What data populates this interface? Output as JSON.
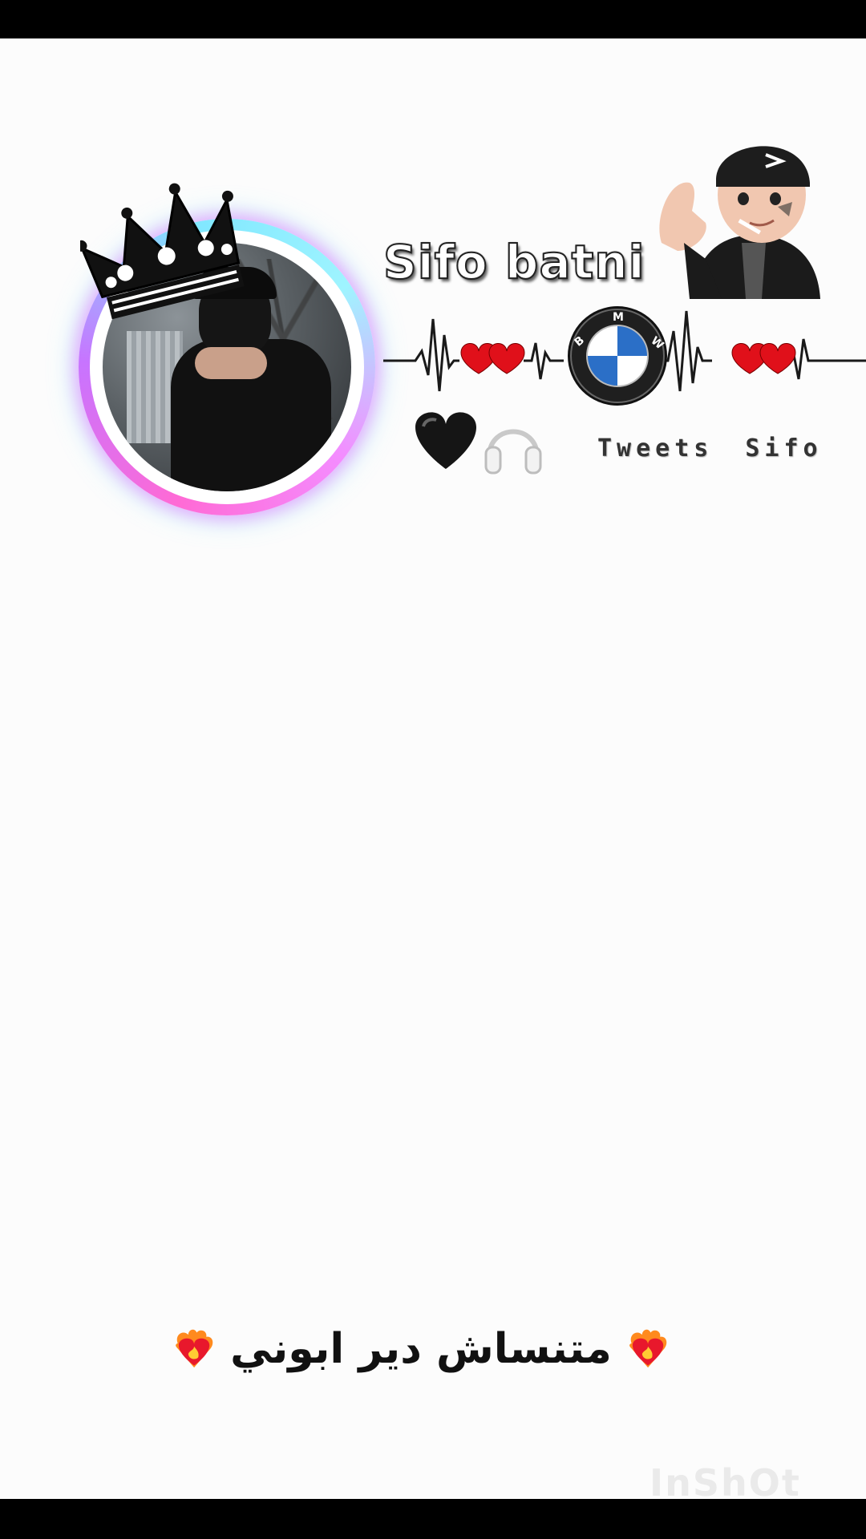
{
  "profile": {
    "display_name": "Sifo batni",
    "tweets_word": "Tweets",
    "tweets_name": "Sifo",
    "avatar_icon": "profile-photo",
    "crown_icon": "crown-icon",
    "ring_colors": [
      "#ff6ad5",
      "#c774ff",
      "#7fe7ff"
    ],
    "character_icon": "memoji-character",
    "brand_icon": "bmw-logo",
    "brand_letters": [
      "B",
      "M",
      "W"
    ],
    "decor_icons": [
      "red-hearts-icon",
      "black-heart-icon",
      "headphones-icon"
    ]
  },
  "caption": {
    "text": "متنساش دير ابوني",
    "icon": "heart-on-fire-icon"
  },
  "watermark": {
    "text": "InShOt"
  },
  "colors": {
    "background": "#fcfcfc",
    "frame": "#000000",
    "heart_red": "#e0101a"
  }
}
